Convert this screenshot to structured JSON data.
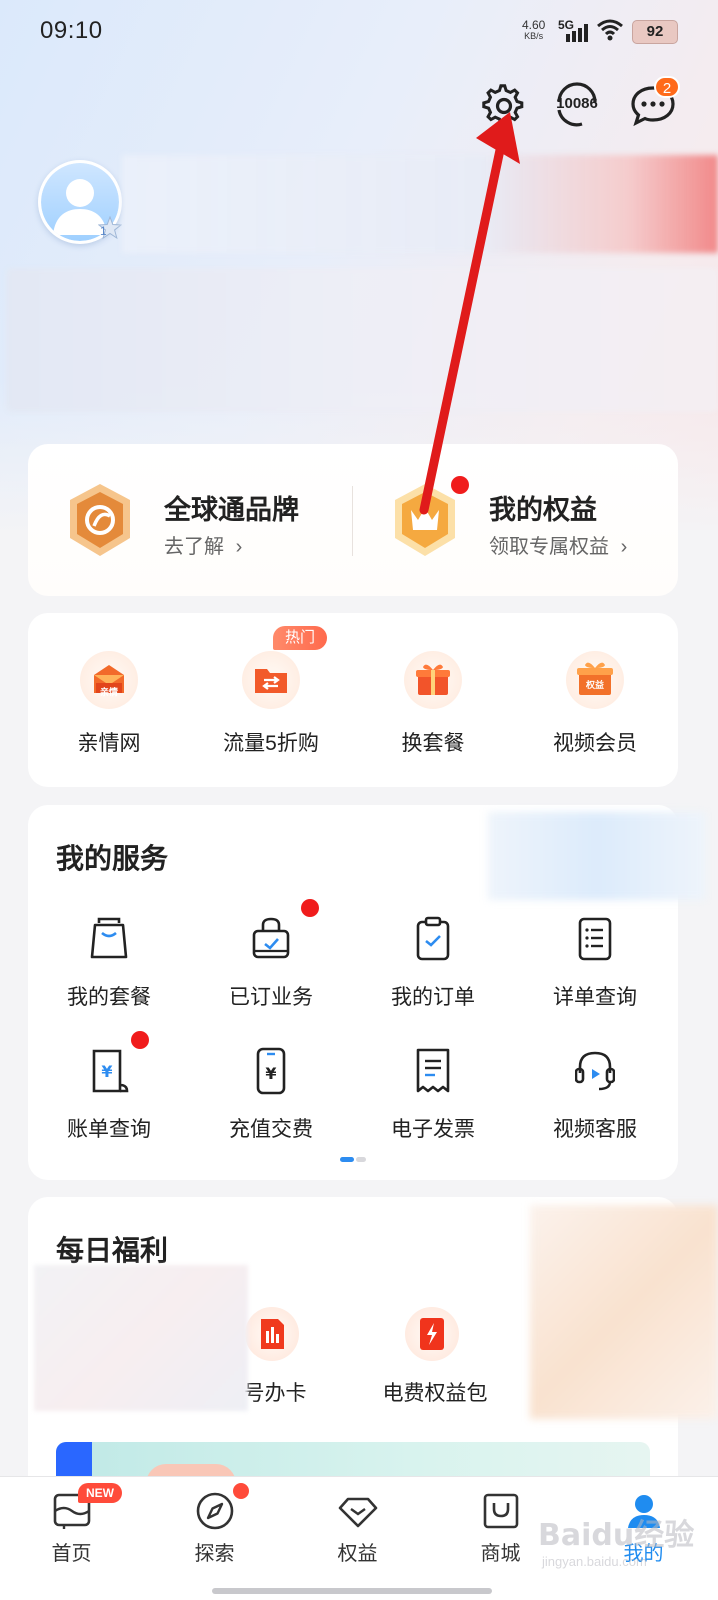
{
  "status_bar": {
    "time": "09:10",
    "net_speed_value": "4.60",
    "net_speed_unit": "KB/s",
    "network": "5G",
    "battery": "92"
  },
  "header": {
    "settings_icon": "gear-icon",
    "service_hotline": "10086",
    "message_badge": "2"
  },
  "profile": {
    "level": "1"
  },
  "brand_cards": [
    {
      "title": "全球通品牌",
      "sub": "去了解",
      "icon": "global-brand-icon"
    },
    {
      "title": "我的权益",
      "sub": "领取专属权益",
      "icon": "crown-icon"
    }
  ],
  "shortcuts": {
    "hot_tag": "热门",
    "items": [
      {
        "label": "亲情网",
        "icon": "family-network-icon",
        "icon_text": "亲情"
      },
      {
        "label": "流量5折购",
        "icon": "data-folder-icon"
      },
      {
        "label": "换套餐",
        "icon": "gift-box-icon"
      },
      {
        "label": "视频会员",
        "icon": "vip-gift-icon",
        "icon_text": "权益"
      }
    ]
  },
  "services": {
    "title": "我的服务",
    "items": [
      {
        "label": "我的套餐",
        "icon": "shopping-bag-icon"
      },
      {
        "label": "已订业务",
        "icon": "subscribed-bag-icon"
      },
      {
        "label": "我的订单",
        "icon": "order-clipboard-icon"
      },
      {
        "label": "详单查询",
        "icon": "detail-list-icon"
      },
      {
        "label": "账单查询",
        "icon": "bill-icon"
      },
      {
        "label": "充值交费",
        "icon": "recharge-phone-icon"
      },
      {
        "label": "电子发票",
        "icon": "invoice-icon"
      },
      {
        "label": "视频客服",
        "icon": "headset-icon"
      }
    ]
  },
  "daily": {
    "title": "每日福利",
    "items": [
      {
        "label": "号办卡",
        "icon": "sim-card-icon"
      },
      {
        "label": "电费权益包",
        "icon": "electric-bill-icon"
      }
    ]
  },
  "bottom_nav": {
    "new_tag": "NEW",
    "items": [
      {
        "label": "首页",
        "icon": "home-icon"
      },
      {
        "label": "探索",
        "icon": "compass-icon"
      },
      {
        "label": "权益",
        "icon": "diamond-icon"
      },
      {
        "label": "商城",
        "icon": "mall-bag-icon"
      },
      {
        "label": "我的",
        "icon": "profile-icon"
      }
    ]
  },
  "watermark": {
    "text": "Baidu经验",
    "sub": "jingyan.baidu.com"
  },
  "colors": {
    "accent_blue": "#1f8cf0",
    "badge_orange": "#ff6a1a",
    "dot_red": "#f01c1c",
    "arrow_red": "#e01b1b"
  }
}
